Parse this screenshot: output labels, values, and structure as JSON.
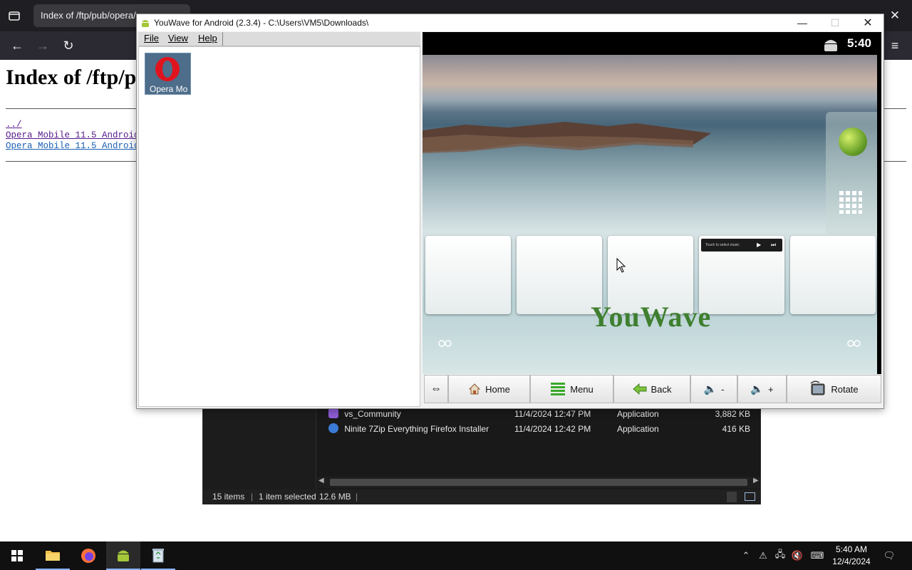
{
  "browser": {
    "tab_title": "Index of /ftp/pub/opera/...",
    "page_heading": "Index of /ftp/pub/opera/",
    "links": [
      "../",
      "Opera_Mobile_11.5_Android...",
      "Opera_Mobile_11.5_Android..."
    ],
    "icons": [
      "tab-list-icon",
      "back-icon",
      "forward-icon",
      "reload-icon",
      "menu-icon"
    ]
  },
  "youwave": {
    "title": "YouWave for Android (2.3.4) - C:\\Users\\VM5\\Downloads\\",
    "menu": [
      "File",
      "View",
      "Help"
    ],
    "file_items": [
      {
        "label": "Opera Mo",
        "icon": "opera-icon"
      }
    ],
    "status_time": "5:40",
    "music_widget_text": "Touch to select music",
    "watermark": "YouWave",
    "controls": {
      "home": "Home",
      "menu": "Menu",
      "back": "Back",
      "vol_down": "-",
      "vol_up": "+",
      "rotate": "Rotate"
    }
  },
  "explorer": {
    "rows": [
      {
        "name": "vs_Community",
        "date": "11/4/2024 12:47 PM",
        "type": "Application",
        "size": "3,882 KB",
        "icon_color": "#8e5bd6"
      },
      {
        "name": "Ninite 7Zip Everything Firefox Installer",
        "date": "11/4/2024 12:42 PM",
        "type": "Application",
        "size": "416 KB",
        "icon_color": "#3a7bd5"
      }
    ],
    "status": {
      "items": "15 items",
      "selected": "1 item selected",
      "size": "12.6 MB"
    }
  },
  "taskbar": {
    "apps": [
      "file-explorer-icon",
      "firefox-icon",
      "youwave-icon",
      "recycle-bin-icon"
    ],
    "clock_time": "5:40 AM",
    "clock_date": "12/4/2024"
  },
  "colors": {
    "accent": "#8ab4ff",
    "opera_red": "#e0141e",
    "android_green": "#a4c639"
  }
}
